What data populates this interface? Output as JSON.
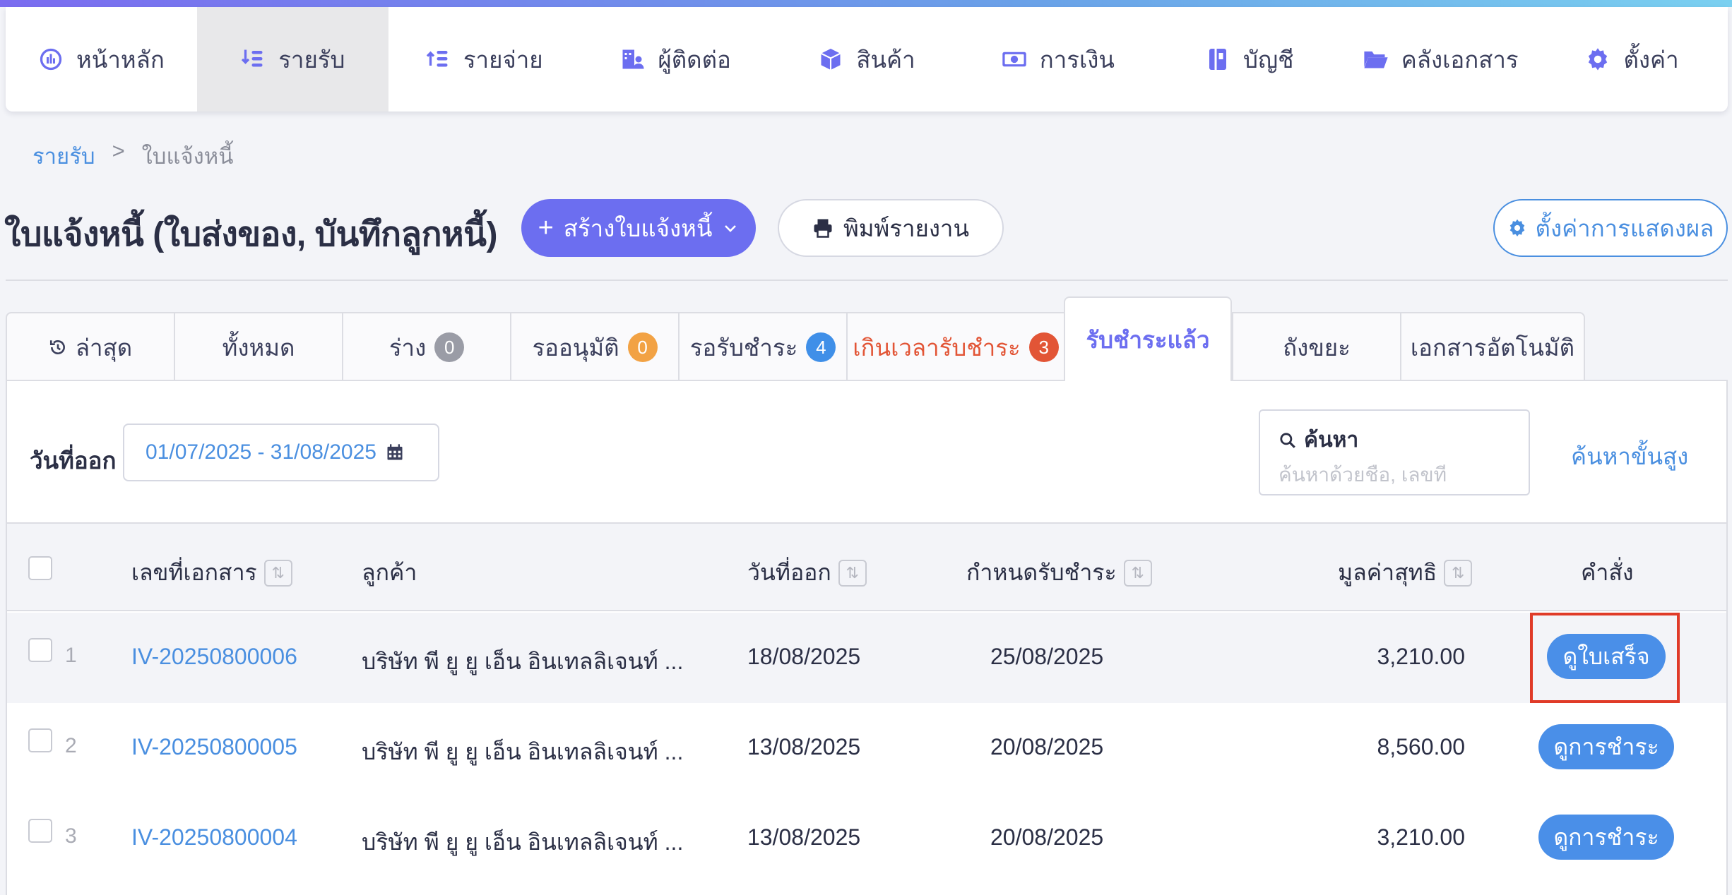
{
  "nav": {
    "items": [
      {
        "label": "หน้าหลัก",
        "icon": "dashboard-icon"
      },
      {
        "label": "รายรับ",
        "icon": "income-icon",
        "active": true
      },
      {
        "label": "รายจ่าย",
        "icon": "expense-icon"
      },
      {
        "label": "ผู้ติดต่อ",
        "icon": "contacts-icon"
      },
      {
        "label": "สินค้า",
        "icon": "box-icon"
      },
      {
        "label": "การเงิน",
        "icon": "money-icon"
      },
      {
        "label": "บัญชี",
        "icon": "ledger-icon"
      },
      {
        "label": "คลังเอกสาร",
        "icon": "folder-icon"
      },
      {
        "label": "ตั้งค่า",
        "icon": "gear-icon"
      }
    ]
  },
  "breadcrumb": {
    "parent": "รายรับ",
    "separator": ">",
    "current": "ใบแจ้งหนี้"
  },
  "page": {
    "title": "ใบแจ้งหนี้ (ใบส่งของ, บันทึกลูกหนี้)",
    "create_button": "สร้างใบแจ้งหนี้",
    "print_button": "พิมพ์รายงาน",
    "display_settings_button": "ตั้งค่าการแสดงผล"
  },
  "tabs": [
    {
      "label": "ล่าสุด",
      "icon": "history-icon"
    },
    {
      "label": "ทั้งหมด"
    },
    {
      "label": "ร่าง",
      "badge": "0",
      "badge_color": "#9a9ca6"
    },
    {
      "label": "รออนุมัติ",
      "badge": "0",
      "badge_color": "#f2a244"
    },
    {
      "label": "รอรับชำระ",
      "badge": "4",
      "badge_color": "#3f8fe8"
    },
    {
      "label": "เกินเวลารับชำระ",
      "badge": "3",
      "badge_color": "#e25536"
    },
    {
      "label": "รับชำระแล้ว",
      "active": true
    },
    {
      "label": "ถังขยะ"
    },
    {
      "label": "เอกสารอัตโนมัติ"
    }
  ],
  "filter": {
    "date_label": "วันที่ออก",
    "date_range": "01/07/2025 - 31/08/2025",
    "search_title": "ค้นหา",
    "search_placeholder": "ค้นหาด้วยชื่อ, เลขที่",
    "advanced_search": "ค้นหาขั้นสูง"
  },
  "table": {
    "headers": {
      "doc_no": "เลขที่เอกสาร",
      "customer": "ลูกค้า",
      "issue_date": "วันที่ออก",
      "due_date": "กำหนดรับชำระ",
      "net_amount": "มูลค่าสุทธิ",
      "action": "คำสั่ง"
    },
    "rows": [
      {
        "index": "1",
        "doc_no": "IV-20250800006",
        "customer": "บริษัท พี ยู ยู เอ็น อินเทลลิเจนท์ ...",
        "issue_date": "18/08/2025",
        "due_date": "25/08/2025",
        "net_amount": "3,210.00",
        "action": "ดูใบเสร็จ"
      },
      {
        "index": "2",
        "doc_no": "IV-20250800005",
        "customer": "บริษัท พี ยู ยู เอ็น อินเทลลิเจนท์ ...",
        "issue_date": "13/08/2025",
        "due_date": "20/08/2025",
        "net_amount": "8,560.00",
        "action": "ดูการชำระ"
      },
      {
        "index": "3",
        "doc_no": "IV-20250800004",
        "customer": "บริษัท พี ยู ยู เอ็น อินเทลลิเจนท์ ...",
        "issue_date": "13/08/2025",
        "due_date": "20/08/2025",
        "net_amount": "3,210.00",
        "action": "ดูการชำระ"
      }
    ]
  },
  "colors": {
    "accent": "#6c6ef0",
    "link": "#4a8fe0",
    "overdue": "#e25536",
    "highlight_frame": "#e03b28"
  }
}
